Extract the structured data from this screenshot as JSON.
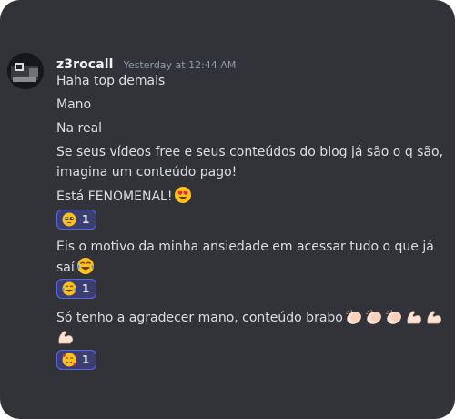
{
  "message": {
    "username": "z3rocall",
    "timestamp": "Yesterday at 12:44 AM",
    "lines": [
      "Haha top demais",
      "Mano",
      "Na real",
      "Se seus vídeos free e seus conteúdos do blog já são o q são,",
      "imagina um conteúdo pago!",
      "Está FENOMENAL!",
      "Eis o motivo da minha ansiedade em acessar tudo o que já",
      "saí",
      "Só tenho a agradecer mano, conteúdo brabo"
    ]
  },
  "reactions": [
    {
      "emoji": "pleading-face",
      "count": "1"
    },
    {
      "emoji": "joy-face",
      "count": "1"
    },
    {
      "emoji": "smiling-hearts-face",
      "count": "1"
    }
  ],
  "icons": {
    "avatar": "user-avatar",
    "inline_emojis": [
      "heart-eyes-emoji",
      "joy-emoji",
      "clap-emoji",
      "flexed-biceps-emoji"
    ]
  },
  "colors": {
    "background": "#323339",
    "accent": "#5865f2",
    "reaction_bg": "#3c3f6e",
    "text": "#dbdee1",
    "username": "#f2f3f5",
    "timestamp": "#949ba4"
  }
}
